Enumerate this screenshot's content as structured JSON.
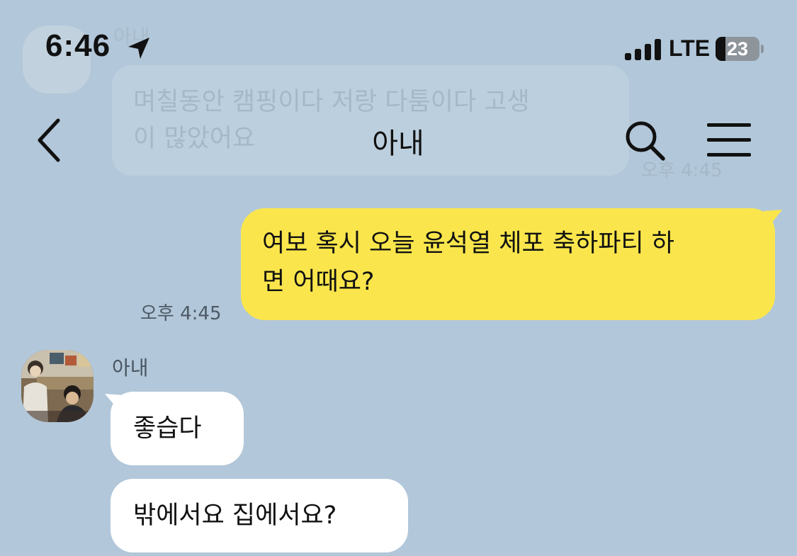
{
  "status_bar": {
    "time": "6:46",
    "network": "LTE",
    "battery": "23",
    "battery_percent": 23,
    "signal_bars": 4
  },
  "header": {
    "title": "아내",
    "back_icon": "chevron-left-icon",
    "search_icon": "search-icon",
    "menu_icon": "hamburger-menu-icon"
  },
  "faded_message": {
    "sender": "아내",
    "text": "며칠동안 캠핑이다 저랑 다툼이다 고생\n이 많았어요",
    "time": "오후 4:45"
  },
  "messages": {
    "outgoing": {
      "line1": "여보 혹시 오늘 윤석열 체포 축하파티 하",
      "line2": "면 어때요?",
      "time": "오후 4:45"
    },
    "incoming": {
      "sender": "아내",
      "bubble1": "좋습다",
      "bubble2": "밖에서요 집에서요?"
    }
  },
  "colors": {
    "background": "#b2c7d9",
    "outgoing_bubble": "#fae64c",
    "incoming_bubble": "#ffffff",
    "text": "#111111"
  }
}
